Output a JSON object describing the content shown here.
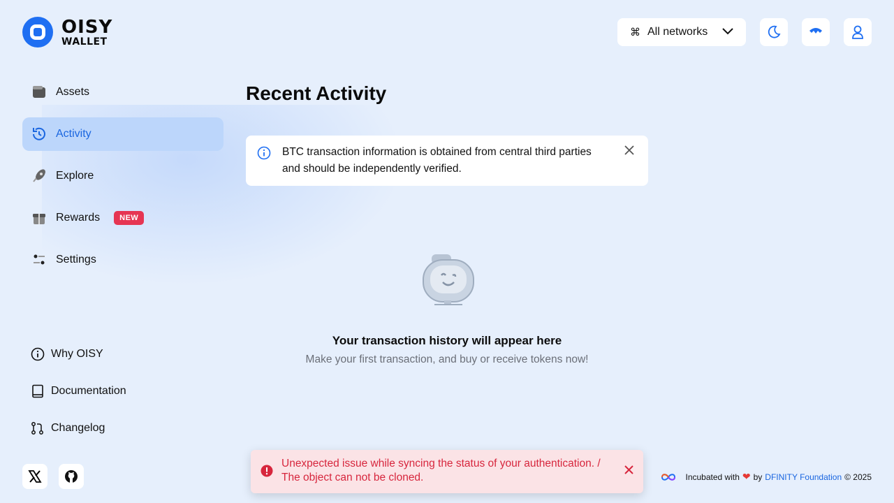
{
  "brand": {
    "line1": "OISY",
    "line2": "WALLET",
    "tm": "™"
  },
  "header": {
    "network_selector": "All networks",
    "network_icon": "command-icon",
    "buttons": [
      "theme-moon-icon",
      "walletconnect-icon",
      "user-icon"
    ]
  },
  "sidebar": {
    "items": [
      {
        "label": "Assets",
        "icon": "wallet-icon",
        "active": false
      },
      {
        "label": "Activity",
        "icon": "history-icon",
        "active": true
      },
      {
        "label": "Explore",
        "icon": "rocket-icon",
        "active": false
      },
      {
        "label": "Rewards",
        "icon": "gift-icon",
        "active": false,
        "badge": "NEW"
      },
      {
        "label": "Settings",
        "icon": "sliders-icon",
        "active": false
      }
    ],
    "links": [
      {
        "label": "Why OISY",
        "icon": "info-icon"
      },
      {
        "label": "Documentation",
        "icon": "book-icon"
      },
      {
        "label": "Changelog",
        "icon": "git-pull-icon"
      }
    ],
    "social": [
      "x-icon",
      "github-icon"
    ]
  },
  "main": {
    "title": "Recent Activity",
    "info": "BTC transaction information is obtained from central third parties and should be independently verified.",
    "empty_heading": "Your transaction history will appear here",
    "empty_sub": "Make your first transaction, and buy or receive tokens now!"
  },
  "toast": {
    "message": "Unexpected issue while syncing the status of your authentication. / The object can not be cloned."
  },
  "footer": {
    "prefix": "Incubated with",
    "by": "by",
    "org": "DFINITY Foundation",
    "copyright": "© 2025"
  },
  "colors": {
    "accent": "#1f6ff2",
    "active_bg": "#bcd6fb",
    "badge": "#e63553",
    "error": "#d7263d",
    "page_bg": "#e6effc"
  }
}
